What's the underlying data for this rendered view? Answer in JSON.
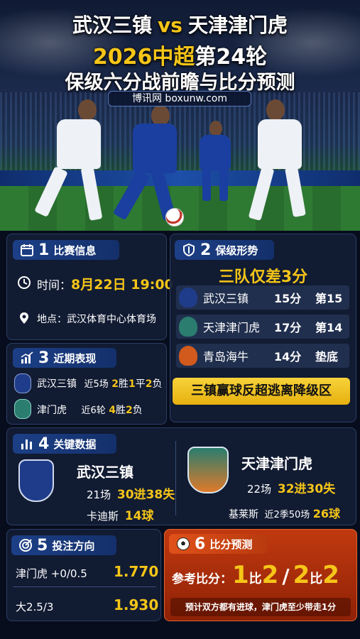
{
  "header": {
    "team_home": "武汉三镇",
    "vs": "vs",
    "team_away": "天津津门虎",
    "line2_year": "2026中超",
    "line2_round": "第24轮",
    "line3": "保级六分战前瞻与比分预测",
    "site": "博讯网 boxunw.com"
  },
  "sec1": {
    "num": "1",
    "title": "比赛信息",
    "time_label": "时间：",
    "time_value": "8月22日 19:00",
    "venue_label": "地点：",
    "venue_value": "武汉体育中心体育场"
  },
  "sec2": {
    "num": "2",
    "title": "保级形势",
    "headline": "三队仅差3分",
    "rows": [
      {
        "team": "武汉三镇",
        "pts": "15分",
        "rank": "第15",
        "color": "#1f3c8a"
      },
      {
        "team": "天津津门虎",
        "pts": "17分",
        "rank": "第14",
        "color": "#2a7d6f"
      },
      {
        "team": "青岛海牛",
        "pts": "14分",
        "rank": "垫底",
        "color": "#d15a1c"
      }
    ],
    "banner": "三镇赢球反超逃离降级区"
  },
  "sec3": {
    "num": "3",
    "title": "近期表现",
    "rows": [
      {
        "team": "武汉三镇",
        "label": "近5场",
        "w": "2",
        "w_unit": "胜",
        "d": "1",
        "d_unit": "平",
        "l": "2",
        "l_unit": "负"
      },
      {
        "team": "津门虎",
        "label": "近6轮",
        "w": "4",
        "w_unit": "胜",
        "l": "2",
        "l_unit": "负"
      }
    ]
  },
  "sec4": {
    "num": "4",
    "title": "关键数据",
    "home": {
      "name": "武汉三镇",
      "games": "21场",
      "gf_ga": "30进38失",
      "scorer": "卡迪斯",
      "goals": "14球"
    },
    "away": {
      "name": "天津津门虎",
      "games": "22场",
      "gf_ga": "32进30失",
      "scorer": "基莱斯",
      "scorer_note": "近2季50场",
      "goals": "26球"
    }
  },
  "sec5": {
    "num": "5",
    "title": "投注方向",
    "rows": [
      {
        "label": "津门虎 +0/0.5",
        "odds": "1.770"
      },
      {
        "label": "大2.5/3",
        "odds": "1.930"
      }
    ]
  },
  "sec6": {
    "num": "6",
    "title": "比分预测",
    "ref_label": "参考比分：",
    "score1_a": "1",
    "score1_sep": "比",
    "score1_b": "2",
    "slash": "/",
    "score2_a": "2",
    "score2_sep": "比",
    "score2_b": "2",
    "note": "预计双方都有进球，津门虎至少带走1分"
  },
  "colors": {
    "accent": "#f5c518",
    "panel": "#121c34",
    "title_bar": "#1c3f86",
    "predict": "#c1390f"
  }
}
